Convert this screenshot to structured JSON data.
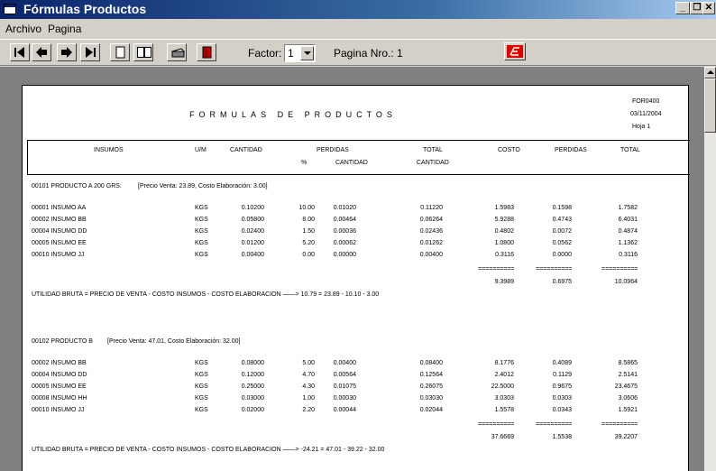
{
  "window": {
    "title": "Fórmulas Productos"
  },
  "menu": {
    "archivo": "Archivo",
    "pagina": "Pagina"
  },
  "toolbar": {
    "factor_label": "Factor:",
    "factor_value": "1",
    "pagina_label": "Pagina Nro.: 1"
  },
  "report": {
    "code": "FOR0400",
    "date": "03/11/2004",
    "sheet": "Hoja   1",
    "title": "FORMULAS DE PRODUCTOS",
    "headers": {
      "insumos": "INSUMOS",
      "um": "U/M",
      "cantidad": "CANTIDAD",
      "perdidas": "PERDIDAS",
      "pct": "%",
      "perd_cantidad": "CANTIDAD",
      "total": "TOTAL",
      "total_cantidad": "CANTIDAD",
      "costo": "COSTO",
      "perdidas2": "PERDIDAS",
      "total2": "TOTAL"
    },
    "products": [
      {
        "heading": "00101 PRODUCTO A 200 GRS.",
        "price_note": "[Precio Venta: 23.89, Costo Elaboración: 3.00]",
        "rows": [
          [
            "00001 INSUMO AA",
            "KGS",
            "0.10200",
            "10.00",
            "0.01020",
            "0.11220",
            "1.5983",
            "0.1598",
            "1.7582"
          ],
          [
            "00002 INSUMO BB",
            "KGS",
            "0.05800",
            "8.00",
            "0.00464",
            "0.06264",
            "5.9288",
            "0.4743",
            "6.4031"
          ],
          [
            "00004 INSUMO DD",
            "KGS",
            "0.02400",
            "1.50",
            "0.00036",
            "0.02436",
            "0.4802",
            "0.0072",
            "0.4874"
          ],
          [
            "00005 INSUMO EE",
            "KGS",
            "0.01200",
            "5.20",
            "0.00062",
            "0.01262",
            "1.0800",
            "0.0562",
            "1.1362"
          ],
          [
            "00010 INSUMO JJ",
            "KGS",
            "0.00400",
            "0.00",
            "0.00000",
            "0.00400",
            "0.3116",
            "0.0000",
            "0.3116"
          ]
        ],
        "separator": "===========",
        "totals": [
          "9.3989",
          "0.6975",
          "10.0964"
        ],
        "utilidad": "UTILIDAD BRUTA = PRECIO DE VENTA - COSTO INSUMOS - COSTO ELABORACION ——> 10.79 = 23.89 - 10.10 - 3.00"
      },
      {
        "heading": "00102 PRODUCTO B",
        "price_note": "[Precio Venta: 47.01, Costo Elaboración: 32.00]",
        "rows": [
          [
            "00002 INSUMO BB",
            "KGS",
            "0.08000",
            "5.00",
            "0.00400",
            "0.08400",
            "8.1776",
            "0.4089",
            "8.5865"
          ],
          [
            "00004 INSUMO DD",
            "KGS",
            "0.12000",
            "4.70",
            "0.00564",
            "0.12564",
            "2.4012",
            "0.1129",
            "2.5141"
          ],
          [
            "00005 INSUMO EE",
            "KGS",
            "0.25000",
            "4.30",
            "0.01075",
            "0.26075",
            "22.5000",
            "0.9675",
            "23.4675"
          ],
          [
            "00008 INSUMO HH",
            "KGS",
            "0.03000",
            "1.00",
            "0.00030",
            "0.03030",
            "3.0303",
            "0.0303",
            "3.0606"
          ],
          [
            "00010 INSUMO JJ",
            "KGS",
            "0.02000",
            "2.20",
            "0.00044",
            "0.02044",
            "1.5578",
            "0.0343",
            "1.5921"
          ]
        ],
        "separator": "===========",
        "totals": [
          "37.6669",
          "1.5538",
          "39.2207"
        ],
        "utilidad": "UTILIDAD BRUTA = PRECIO DE VENTA - COSTO INSUMOS - COSTO ELABORACION ——> -24.21 = 47.01 - 39.22 - 32.00"
      }
    ]
  }
}
